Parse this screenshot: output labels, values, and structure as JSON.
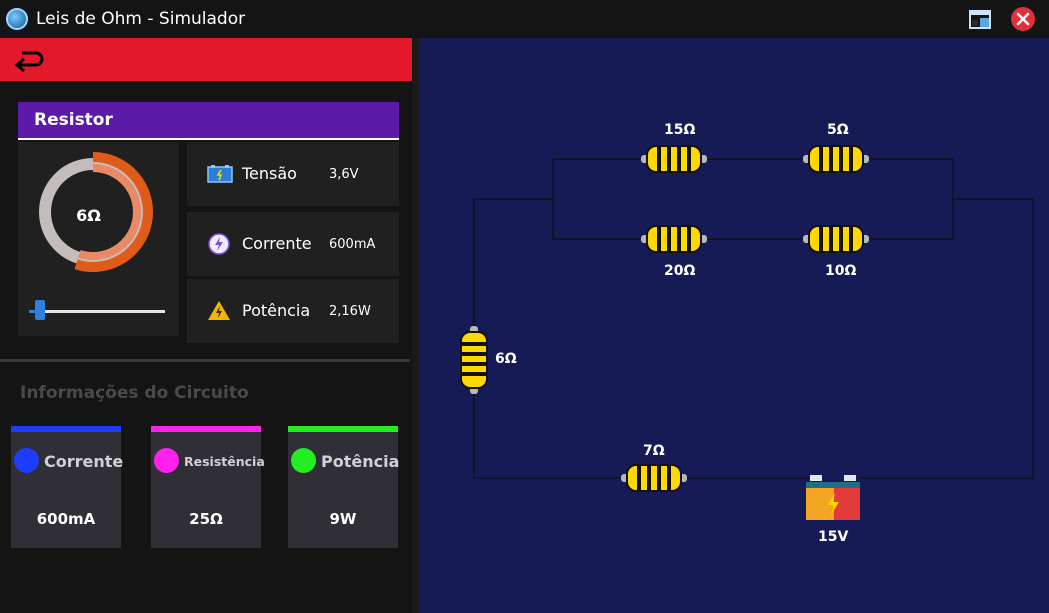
{
  "window": {
    "title": "Leis de Ohm - Simulador",
    "icons": [
      "globe-app-icon",
      "restore-window-icon",
      "close-icon"
    ]
  },
  "back": {
    "icon": "return-arrow-icon"
  },
  "resistor_panel": {
    "title": "Resistor",
    "gauge_value": "6Ω",
    "gauge_fraction": 0.55,
    "slider_fraction": 0.08,
    "metrics": [
      {
        "label": "Tensão",
        "value": "3,6V",
        "icon": "battery-icon"
      },
      {
        "label": "Corrente",
        "value": "600mA",
        "icon": "lightning-circle-icon"
      },
      {
        "label": "Potência",
        "value": "2,16W",
        "icon": "warning-icon"
      }
    ]
  },
  "circuit_info": {
    "title": "Informações do Circuito",
    "cards": [
      {
        "label": "Corrente",
        "value": "600mA",
        "color": "#1e3cff"
      },
      {
        "label": "Resistência",
        "value": "25Ω",
        "color": "#ff22ee"
      },
      {
        "label": "Potência",
        "value": "9W",
        "color": "#22ee22"
      }
    ]
  },
  "circuit": {
    "resistors": [
      "15Ω",
      "5Ω",
      "20Ω",
      "10Ω",
      "6Ω",
      "7Ω"
    ],
    "battery": "15V"
  },
  "colors": {
    "accent_red": "#e3182b",
    "header_purple": "#5b1aa8",
    "circuit_bg": "#161b56",
    "resistor_yellow": "#ffd800",
    "gauge_orange": "#e05a1a"
  }
}
